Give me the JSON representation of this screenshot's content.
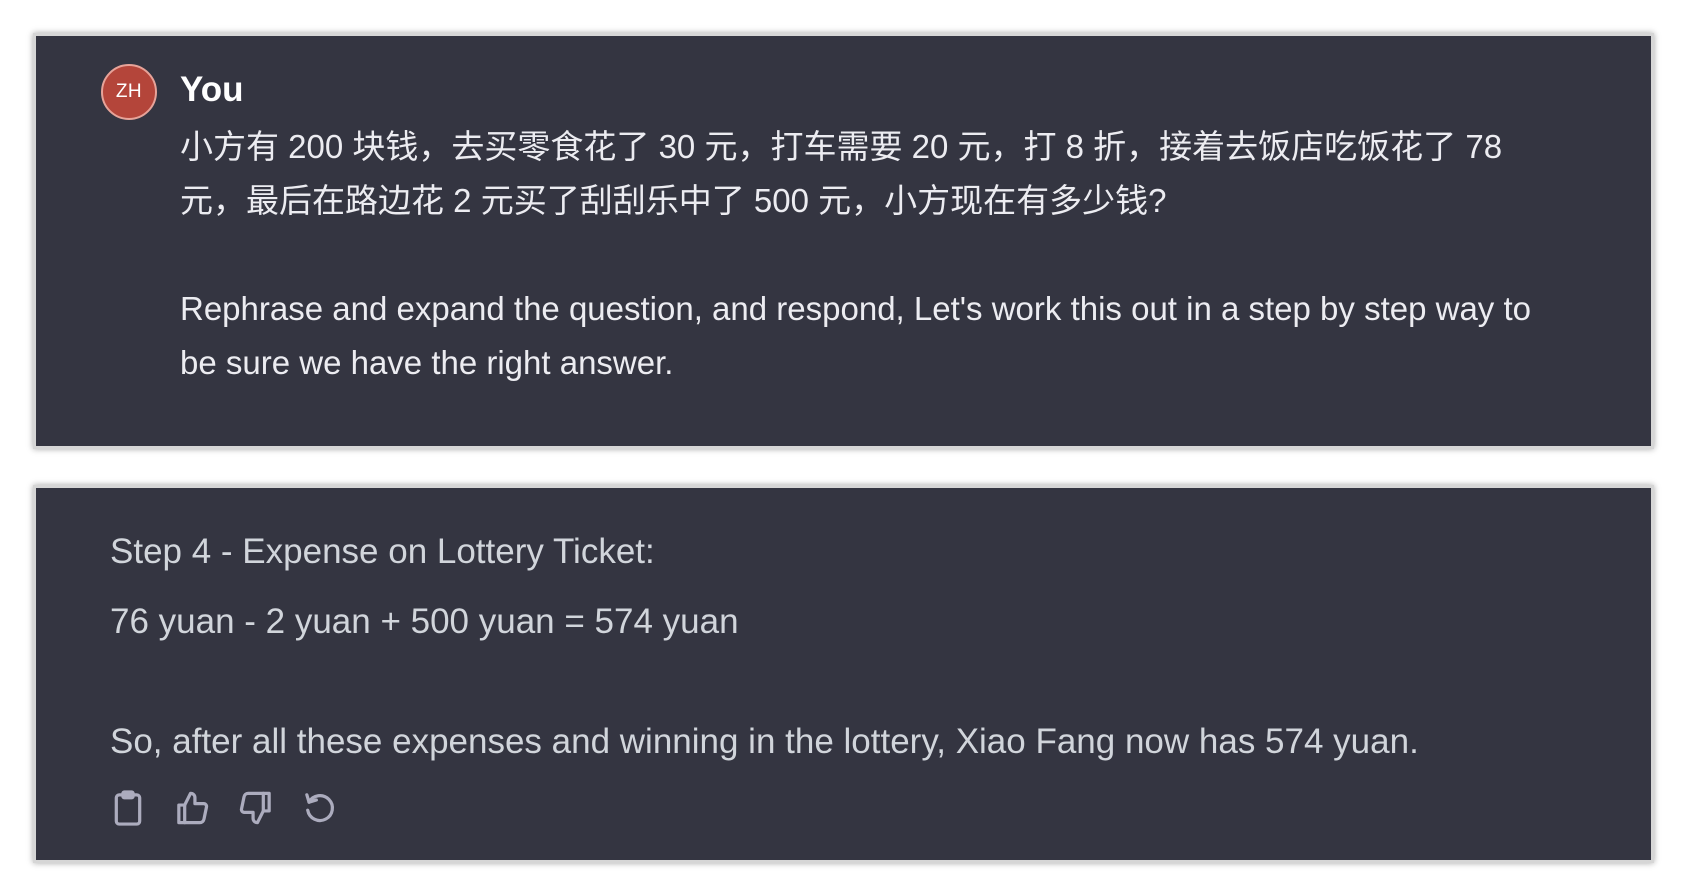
{
  "user_message": {
    "avatar_initials": "ZH",
    "author": "You",
    "question_zh": "小方有 200 块钱，去买零食花了 30 元，打车需要 20 元，打 8 折，接着去饭店吃饭花了 78 元，最后在路边花 2 元买了刮刮乐中了 500 元，小方现在有多少钱?",
    "instruction": "Rephrase and expand the question, and respond, Let's work this out in a step by step way to be sure we have the right answer."
  },
  "assistant_message": {
    "step_heading": "Step 4 - Expense on Lottery Ticket:",
    "formula": "76 yuan - 2 yuan + 500 yuan = 574 yuan",
    "conclusion": "So, after all these expenses and winning in the lottery, Xiao Fang now has 574 yuan.",
    "actions": [
      "clipboard-icon",
      "thumbs-up-icon",
      "thumbs-down-icon",
      "regenerate-icon"
    ]
  },
  "colors": {
    "panel_background": "#343541",
    "avatar_background": "#b4453a",
    "user_text": "#ececf1",
    "assistant_text": "#d1d5db",
    "icon": "#acacbe"
  }
}
